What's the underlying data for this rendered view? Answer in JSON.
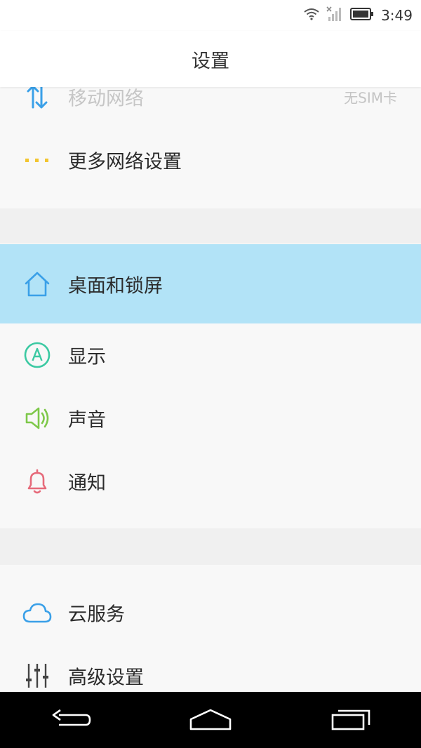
{
  "status_bar": {
    "time": "3:49",
    "icons": [
      "wifi-icon",
      "no-signal-icon",
      "battery-icon"
    ]
  },
  "header": {
    "title": "设置"
  },
  "sections": {
    "network": [
      {
        "label": "移动网络",
        "value": "无SIM卡",
        "icon": "data-arrows-icon",
        "disabled": true
      },
      {
        "label": "更多网络设置",
        "icon": "more-dots-icon"
      }
    ],
    "personal": [
      {
        "label": "桌面和锁屏",
        "icon": "home-icon",
        "selected": true
      },
      {
        "label": "显示",
        "icon": "display-icon"
      },
      {
        "label": "声音",
        "icon": "speaker-icon"
      },
      {
        "label": "通知",
        "icon": "bell-icon"
      }
    ],
    "system": [
      {
        "label": "云服务",
        "icon": "cloud-icon"
      },
      {
        "label": "高级设置",
        "icon": "sliders-icon"
      }
    ]
  },
  "nav_bar": {
    "buttons": [
      "back-icon",
      "home-nav-icon",
      "recents-icon"
    ]
  },
  "colors": {
    "accent_blue": "#3aa0e8",
    "selected_bg": "#b2e3f7",
    "display_green": "#3bc9a2",
    "sound_green": "#7ec84a",
    "bell_red": "#e66a7a",
    "dots_yellow": "#f2c530"
  }
}
